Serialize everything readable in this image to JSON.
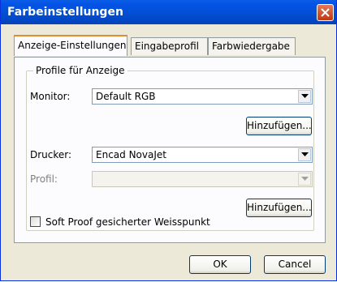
{
  "window": {
    "title": "Farbeinstellungen"
  },
  "tabs": [
    {
      "label": "Anzeige-Einstellungen",
      "active": true
    },
    {
      "label": "Eingabeprofil",
      "active": false
    },
    {
      "label": "Farbwiedergabe",
      "active": false
    }
  ],
  "group": {
    "title": "Profile für Anzeige",
    "monitor_label": "Monitor:",
    "monitor_value": "Default RGB",
    "add_label_1": "Hinzufügen...",
    "printer_label": "Drucker:",
    "printer_value": "Encad NovaJet",
    "profile_label": "Profil:",
    "profile_value": "",
    "add_label_2": "Hinzufügen...",
    "softproof_label": "Soft Proof gesicherter Weisspunkt",
    "softproof_checked": false
  },
  "buttons": {
    "ok": "OK",
    "cancel": "Cancel"
  },
  "colors": {
    "titlebar": "#0553E6",
    "window_bg": "#ECE9D8",
    "tab_highlight": "#E68B2C"
  },
  "icons": {
    "close": "close-icon",
    "dropdown": "chevron-down-icon"
  }
}
